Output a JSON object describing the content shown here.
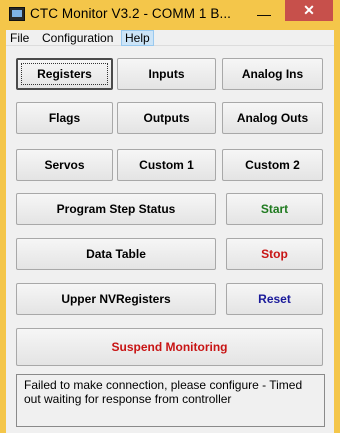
{
  "window": {
    "title": "CTC Monitor V3.2 - COMM 1 B...",
    "minimize_glyph": "—",
    "close_glyph": "✕"
  },
  "menu": {
    "items": [
      {
        "label": "File"
      },
      {
        "label": "Configuration"
      },
      {
        "label": "Help"
      }
    ]
  },
  "buttons": {
    "registers": "Registers",
    "inputs": "Inputs",
    "analog_ins": "Analog Ins",
    "flags": "Flags",
    "outputs": "Outputs",
    "analog_outs": "Analog Outs",
    "servos": "Servos",
    "custom1": "Custom 1",
    "custom2": "Custom 2",
    "program_step_status": "Program Step Status",
    "start": "Start",
    "data_table": "Data Table",
    "stop": "Stop",
    "upper_nvregisters": "Upper NVRegisters",
    "reset": "Reset",
    "suspend_monitoring": "Suspend Monitoring"
  },
  "status": {
    "message": "Failed to make connection, please configure - Timed out waiting for response from controller"
  },
  "colors": {
    "start": "#1f7a1f",
    "stop": "#c81414",
    "reset": "#1a1a9a",
    "suspend": "#c81414",
    "titlebar": "#f4c64a",
    "close": "#c7504b"
  },
  "icons": {
    "app": "monitor-icon"
  }
}
